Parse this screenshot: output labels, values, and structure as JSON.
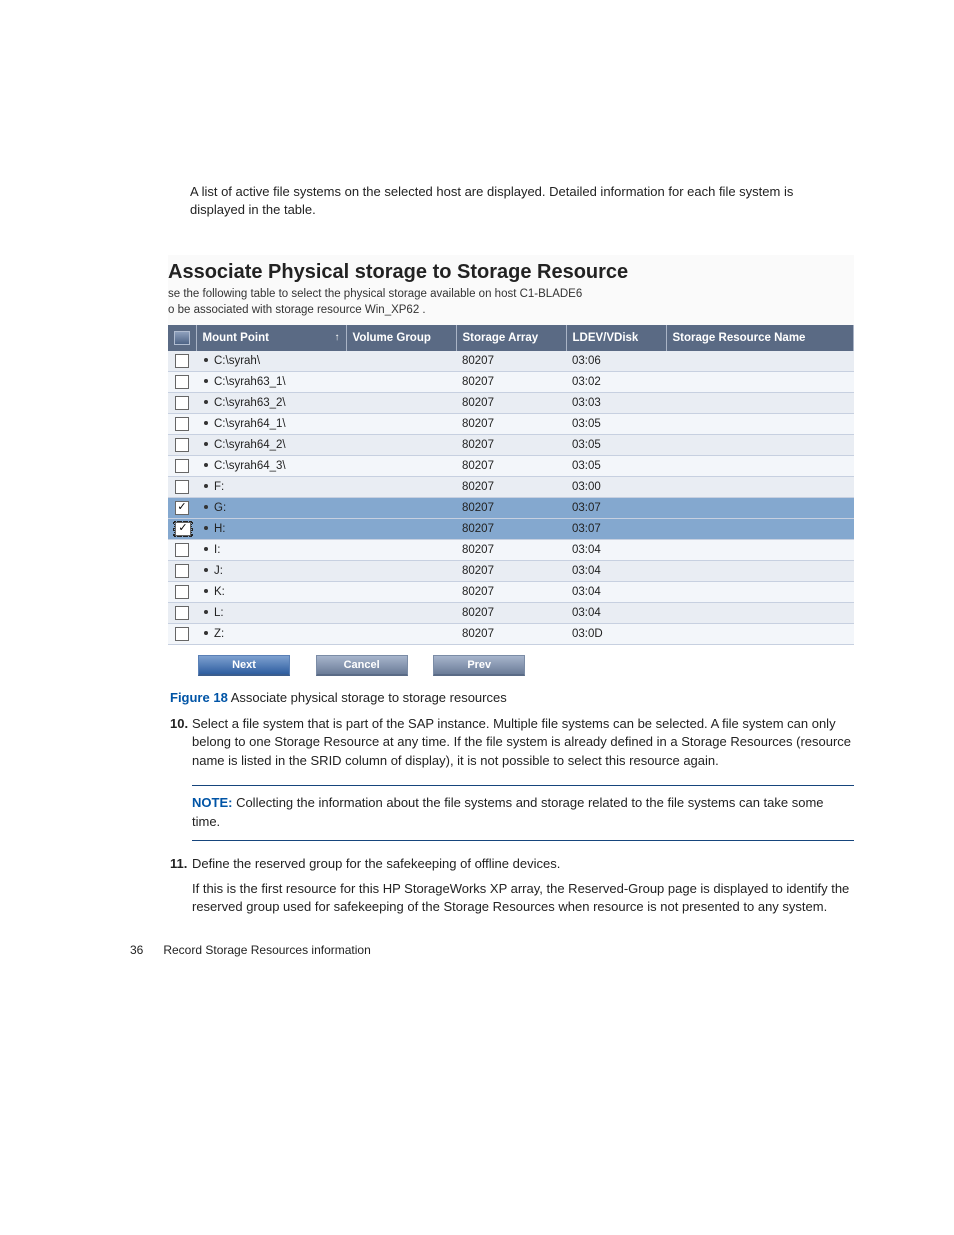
{
  "intro": "A list of active file systems on the selected host are displayed. Detailed information for each file system is displayed in the table.",
  "screenshot": {
    "title": "Associate Physical storage to Storage Resource",
    "sub_line1": "se the following table to select the physical storage available on host C1-BLADE6",
    "sub_line2": "o be associated with storage resource Win_XP62 .",
    "columns": [
      "Mount Point",
      "Volume Group",
      "Storage Array",
      "LDEV/VDisk",
      "Storage Resource Name"
    ],
    "sort_col": 0,
    "rows": [
      {
        "checked": false,
        "focus": false,
        "mount": "C:\\syrah\\",
        "vgroup": "",
        "array": "80207",
        "ldev": "03:06",
        "srname": ""
      },
      {
        "checked": false,
        "focus": false,
        "mount": "C:\\syrah63_1\\",
        "vgroup": "",
        "array": "80207",
        "ldev": "03:02",
        "srname": ""
      },
      {
        "checked": false,
        "focus": false,
        "mount": "C:\\syrah63_2\\",
        "vgroup": "",
        "array": "80207",
        "ldev": "03:03",
        "srname": ""
      },
      {
        "checked": false,
        "focus": false,
        "mount": "C:\\syrah64_1\\",
        "vgroup": "",
        "array": "80207",
        "ldev": "03:05",
        "srname": ""
      },
      {
        "checked": false,
        "focus": false,
        "mount": "C:\\syrah64_2\\",
        "vgroup": "",
        "array": "80207",
        "ldev": "03:05",
        "srname": ""
      },
      {
        "checked": false,
        "focus": false,
        "mount": "C:\\syrah64_3\\",
        "vgroup": "",
        "array": "80207",
        "ldev": "03:05",
        "srname": ""
      },
      {
        "checked": false,
        "focus": false,
        "mount": "F:",
        "vgroup": "",
        "array": "80207",
        "ldev": "03:00",
        "srname": ""
      },
      {
        "checked": true,
        "focus": false,
        "mount": "G:",
        "vgroup": "",
        "array": "80207",
        "ldev": "03:07",
        "srname": ""
      },
      {
        "checked": true,
        "focus": true,
        "mount": "H:",
        "vgroup": "",
        "array": "80207",
        "ldev": "03:07",
        "srname": ""
      },
      {
        "checked": false,
        "focus": false,
        "mount": "I:",
        "vgroup": "",
        "array": "80207",
        "ldev": "03:04",
        "srname": ""
      },
      {
        "checked": false,
        "focus": false,
        "mount": "J:",
        "vgroup": "",
        "array": "80207",
        "ldev": "03:04",
        "srname": ""
      },
      {
        "checked": false,
        "focus": false,
        "mount": "K:",
        "vgroup": "",
        "array": "80207",
        "ldev": "03:04",
        "srname": ""
      },
      {
        "checked": false,
        "focus": false,
        "mount": "L:",
        "vgroup": "",
        "array": "80207",
        "ldev": "03:04",
        "srname": ""
      },
      {
        "checked": false,
        "focus": false,
        "mount": "Z:",
        "vgroup": "",
        "array": "80207",
        "ldev": "03:0D",
        "srname": ""
      }
    ],
    "buttons": {
      "next": "Next",
      "cancel": "Cancel",
      "prev": "Prev"
    }
  },
  "caption": {
    "label": "Figure 18",
    "text": " Associate physical storage to storage resources"
  },
  "step10": {
    "num": "10.",
    "text": "Select a file system that is part of the SAP instance. Multiple file systems can be selected. A file system can only belong to one Storage Resource at any time. If the file system is already defined in a Storage Resources (resource name is listed in the SRID column of display), it is not possible to select this resource again."
  },
  "note": {
    "label": "NOTE:",
    "text": "   Collecting the information about the file systems and storage related to the file systems can take some time."
  },
  "step11": {
    "num": "11.",
    "text": "Define the reserved group for the safekeeping of offline devices.",
    "sub": "If this is the first resource for this HP StorageWorks XP array, the Reserved-Group page is displayed to identify the reserved group used for safekeeping of the Storage Resources when resource is not presented to any system."
  },
  "footer": {
    "page": "36",
    "title": "Record Storage Resources information"
  }
}
